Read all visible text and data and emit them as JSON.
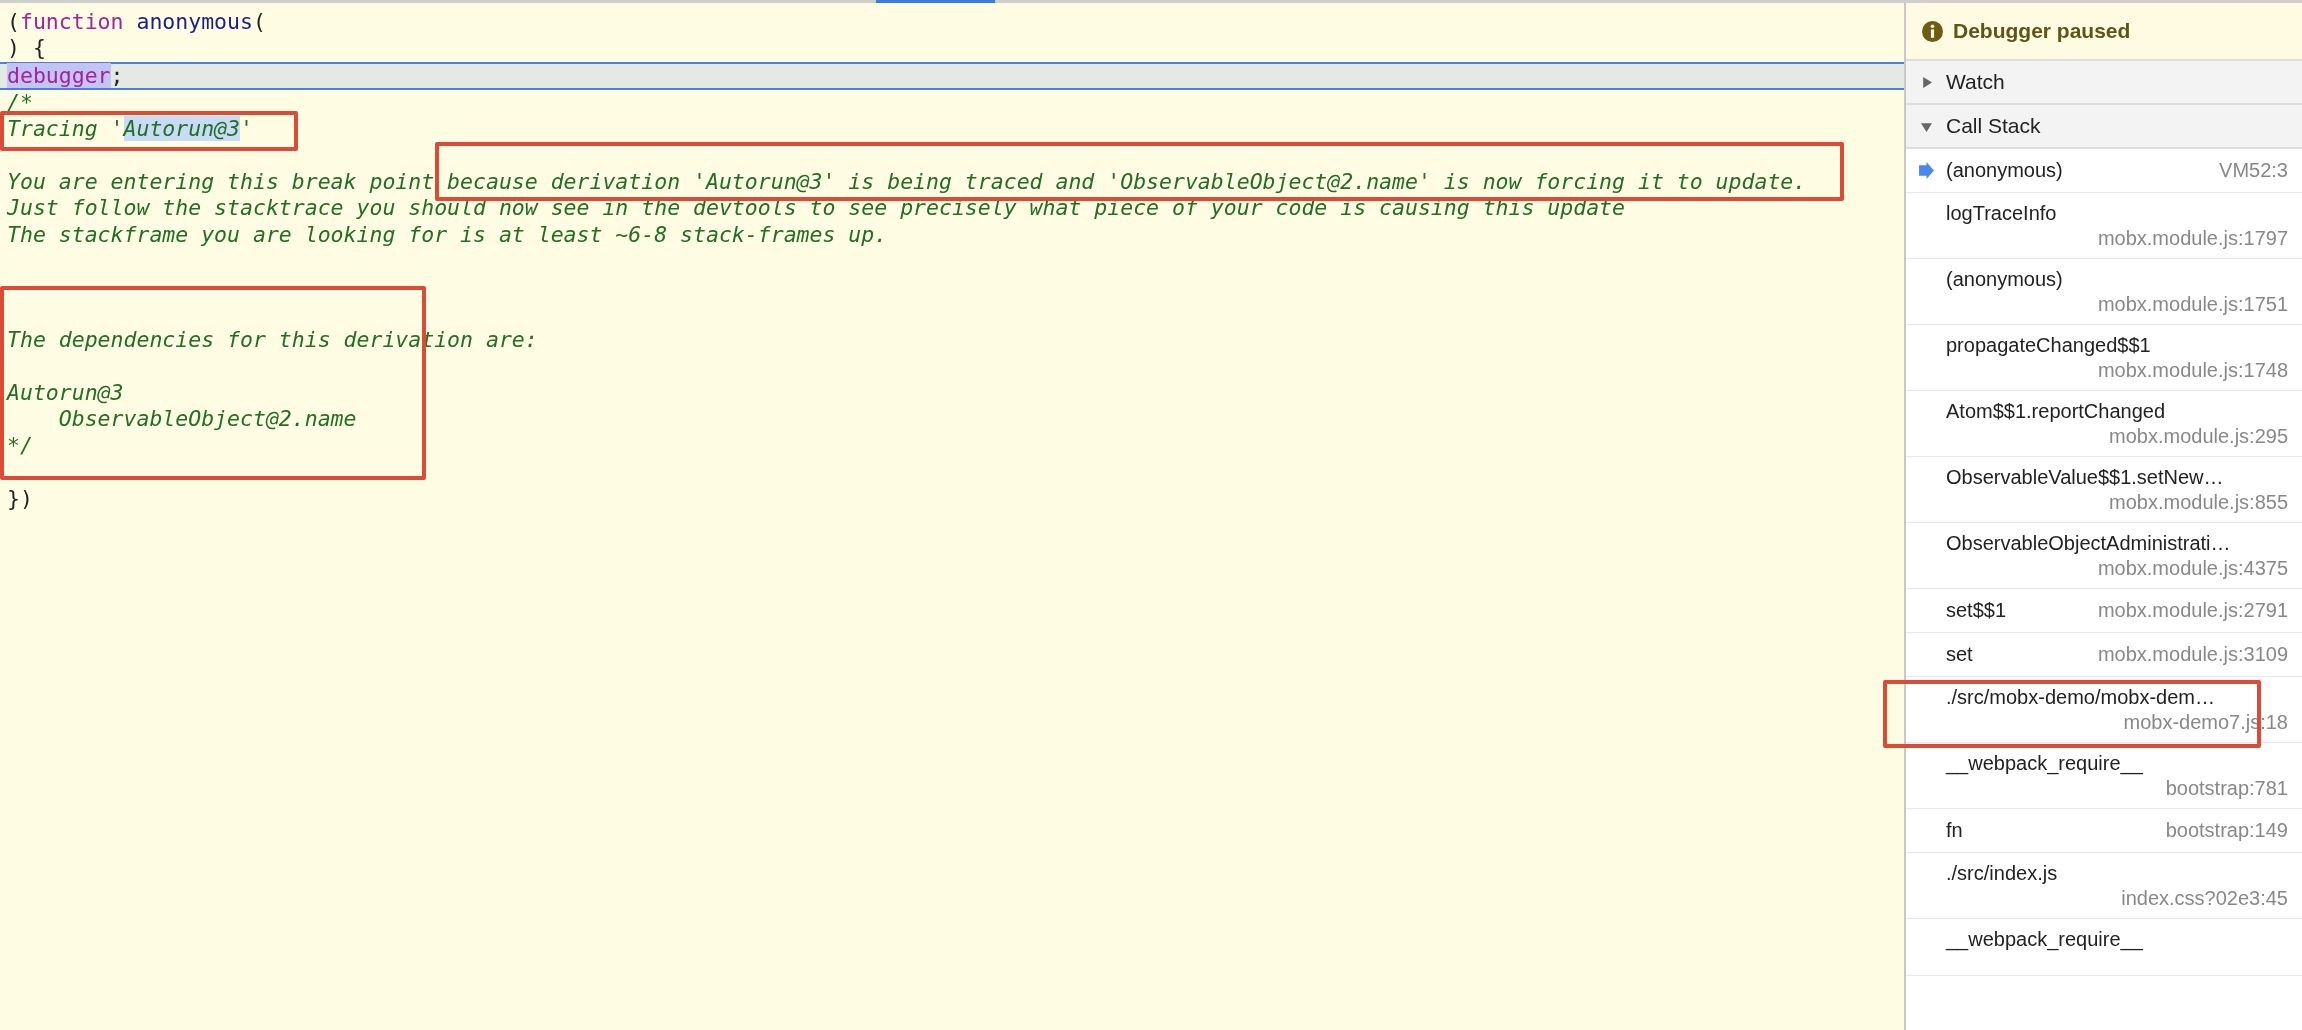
{
  "code_lines": [
    {
      "current": false,
      "segments": [
        {
          "text": "(",
          "kind": "plain"
        },
        {
          "text": "function",
          "kind": "keyword"
        },
        {
          "text": " anonymous",
          "kind": "name"
        },
        {
          "text": "(",
          "kind": "plain"
        }
      ]
    },
    {
      "current": false,
      "segments": [
        {
          "text": ") {",
          "kind": "plain"
        }
      ]
    },
    {
      "current": true,
      "segments": [
        {
          "text": "debugger",
          "kind": "keyword",
          "highlighted": true
        },
        {
          "text": ";",
          "kind": "plain"
        }
      ]
    },
    {
      "current": false,
      "segments": [
        {
          "text": "/*",
          "kind": "comment"
        }
      ]
    },
    {
      "current": false,
      "segments": [
        {
          "text": "Tracing '",
          "kind": "comment"
        },
        {
          "text": "Autorun@3",
          "kind": "comment",
          "highlighted": true
        },
        {
          "text": "'",
          "kind": "comment"
        }
      ]
    },
    {
      "current": false
    },
    {
      "current": false,
      "segments": [
        {
          "text": "You are entering this break point because derivation 'Autorun@3' is being traced and 'ObservableObject@2.name' is now forcing it to update.",
          "kind": "comment"
        }
      ]
    },
    {
      "current": false,
      "segments": [
        {
          "text": "Just follow the stacktrace you should now see in the devtools to see precisely what piece of your code is causing this update",
          "kind": "comment"
        }
      ]
    },
    {
      "current": false,
      "segments": [
        {
          "text": "The stackframe you are looking for is at least ~6-8 stack-frames up.",
          "kind": "comment"
        }
      ]
    },
    {
      "current": false
    },
    {
      "current": false
    },
    {
      "current": false
    },
    {
      "current": false,
      "segments": [
        {
          "text": "The dependencies for this derivation are:",
          "kind": "comment"
        }
      ]
    },
    {
      "current": false
    },
    {
      "current": false,
      "segments": [
        {
          "text": "Autorun@3",
          "kind": "comment"
        }
      ]
    },
    {
      "current": false,
      "segments": [
        {
          "text": "    ObservableObject@2.name",
          "kind": "comment"
        }
      ]
    },
    {
      "current": false,
      "segments": [
        {
          "text": "*/",
          "kind": "comment"
        }
      ]
    },
    {
      "current": false
    },
    {
      "current": false,
      "segments": [
        {
          "text": "})",
          "kind": "plain"
        }
      ]
    }
  ],
  "sidebar": {
    "status": "Debugger paused",
    "sections": [
      {
        "title": "Watch",
        "expanded": false
      },
      {
        "title": "Call Stack",
        "expanded": true
      }
    ],
    "call_stack": [
      {
        "name": "(anonymous)",
        "location": "VM52:3",
        "selected": true,
        "kind": "inline"
      },
      {
        "name": "logTraceInfo",
        "location": "mobx.module.js:1797",
        "selected": false,
        "kind": "stacked"
      },
      {
        "name": "(anonymous)",
        "location": "mobx.module.js:1751",
        "selected": false,
        "kind": "stacked"
      },
      {
        "name": "propagateChanged$$1",
        "location": "mobx.module.js:1748",
        "selected": false,
        "kind": "stacked"
      },
      {
        "name": "Atom$$1.reportChanged",
        "location": "mobx.module.js:295",
        "selected": false,
        "kind": "stacked"
      },
      {
        "name": "ObservableValue$$1.setNew…",
        "location": "mobx.module.js:855",
        "selected": false,
        "kind": "stacked"
      },
      {
        "name": "ObservableObjectAdministrati…",
        "location": "mobx.module.js:4375",
        "selected": false,
        "kind": "stacked"
      },
      {
        "name": "set$$1",
        "location": "mobx.module.js:2791",
        "selected": false,
        "kind": "inline"
      },
      {
        "name": "set",
        "location": "mobx.module.js:3109",
        "selected": false,
        "kind": "inline"
      },
      {
        "name": "./src/mobx-demo/mobx-dem…",
        "location": "mobx-demo7.js:18",
        "selected": false,
        "kind": "stacked"
      },
      {
        "name": "__webpack_require__",
        "location": "bootstrap:781",
        "selected": false,
        "kind": "stacked"
      },
      {
        "name": "fn",
        "location": "bootstrap:149",
        "selected": false,
        "kind": "inline"
      },
      {
        "name": "./src/index.js",
        "location": "index.css?02e3:45",
        "selected": false,
        "kind": "stacked"
      },
      {
        "name": "__webpack_require__",
        "selected": false,
        "kind": "stacked"
      }
    ]
  },
  "annotations": [
    {
      "kind": "box"
    },
    {
      "kind": "box"
    },
    {
      "kind": "box"
    },
    {
      "kind": "box"
    }
  ]
}
